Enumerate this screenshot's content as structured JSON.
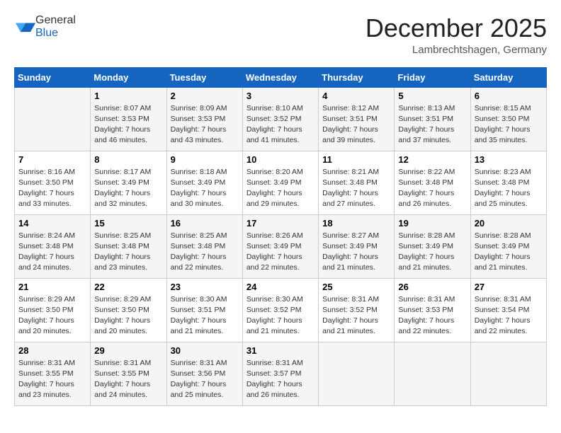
{
  "header": {
    "logo_general": "General",
    "logo_blue": "Blue",
    "month_title": "December 2025",
    "location": "Lambrechtshagen, Germany"
  },
  "days_of_week": [
    "Sunday",
    "Monday",
    "Tuesday",
    "Wednesday",
    "Thursday",
    "Friday",
    "Saturday"
  ],
  "weeks": [
    [
      {
        "num": "",
        "info": ""
      },
      {
        "num": "1",
        "info": "Sunrise: 8:07 AM\nSunset: 3:53 PM\nDaylight: 7 hours\nand 46 minutes."
      },
      {
        "num": "2",
        "info": "Sunrise: 8:09 AM\nSunset: 3:53 PM\nDaylight: 7 hours\nand 43 minutes."
      },
      {
        "num": "3",
        "info": "Sunrise: 8:10 AM\nSunset: 3:52 PM\nDaylight: 7 hours\nand 41 minutes."
      },
      {
        "num": "4",
        "info": "Sunrise: 8:12 AM\nSunset: 3:51 PM\nDaylight: 7 hours\nand 39 minutes."
      },
      {
        "num": "5",
        "info": "Sunrise: 8:13 AM\nSunset: 3:51 PM\nDaylight: 7 hours\nand 37 minutes."
      },
      {
        "num": "6",
        "info": "Sunrise: 8:15 AM\nSunset: 3:50 PM\nDaylight: 7 hours\nand 35 minutes."
      }
    ],
    [
      {
        "num": "7",
        "info": "Sunrise: 8:16 AM\nSunset: 3:50 PM\nDaylight: 7 hours\nand 33 minutes."
      },
      {
        "num": "8",
        "info": "Sunrise: 8:17 AM\nSunset: 3:49 PM\nDaylight: 7 hours\nand 32 minutes."
      },
      {
        "num": "9",
        "info": "Sunrise: 8:18 AM\nSunset: 3:49 PM\nDaylight: 7 hours\nand 30 minutes."
      },
      {
        "num": "10",
        "info": "Sunrise: 8:20 AM\nSunset: 3:49 PM\nDaylight: 7 hours\nand 29 minutes."
      },
      {
        "num": "11",
        "info": "Sunrise: 8:21 AM\nSunset: 3:48 PM\nDaylight: 7 hours\nand 27 minutes."
      },
      {
        "num": "12",
        "info": "Sunrise: 8:22 AM\nSunset: 3:48 PM\nDaylight: 7 hours\nand 26 minutes."
      },
      {
        "num": "13",
        "info": "Sunrise: 8:23 AM\nSunset: 3:48 PM\nDaylight: 7 hours\nand 25 minutes."
      }
    ],
    [
      {
        "num": "14",
        "info": "Sunrise: 8:24 AM\nSunset: 3:48 PM\nDaylight: 7 hours\nand 24 minutes."
      },
      {
        "num": "15",
        "info": "Sunrise: 8:25 AM\nSunset: 3:48 PM\nDaylight: 7 hours\nand 23 minutes."
      },
      {
        "num": "16",
        "info": "Sunrise: 8:25 AM\nSunset: 3:48 PM\nDaylight: 7 hours\nand 22 minutes."
      },
      {
        "num": "17",
        "info": "Sunrise: 8:26 AM\nSunset: 3:49 PM\nDaylight: 7 hours\nand 22 minutes."
      },
      {
        "num": "18",
        "info": "Sunrise: 8:27 AM\nSunset: 3:49 PM\nDaylight: 7 hours\nand 21 minutes."
      },
      {
        "num": "19",
        "info": "Sunrise: 8:28 AM\nSunset: 3:49 PM\nDaylight: 7 hours\nand 21 minutes."
      },
      {
        "num": "20",
        "info": "Sunrise: 8:28 AM\nSunset: 3:49 PM\nDaylight: 7 hours\nand 21 minutes."
      }
    ],
    [
      {
        "num": "21",
        "info": "Sunrise: 8:29 AM\nSunset: 3:50 PM\nDaylight: 7 hours\nand 20 minutes."
      },
      {
        "num": "22",
        "info": "Sunrise: 8:29 AM\nSunset: 3:50 PM\nDaylight: 7 hours\nand 20 minutes."
      },
      {
        "num": "23",
        "info": "Sunrise: 8:30 AM\nSunset: 3:51 PM\nDaylight: 7 hours\nand 21 minutes."
      },
      {
        "num": "24",
        "info": "Sunrise: 8:30 AM\nSunset: 3:52 PM\nDaylight: 7 hours\nand 21 minutes."
      },
      {
        "num": "25",
        "info": "Sunrise: 8:31 AM\nSunset: 3:52 PM\nDaylight: 7 hours\nand 21 minutes."
      },
      {
        "num": "26",
        "info": "Sunrise: 8:31 AM\nSunset: 3:53 PM\nDaylight: 7 hours\nand 22 minutes."
      },
      {
        "num": "27",
        "info": "Sunrise: 8:31 AM\nSunset: 3:54 PM\nDaylight: 7 hours\nand 22 minutes."
      }
    ],
    [
      {
        "num": "28",
        "info": "Sunrise: 8:31 AM\nSunset: 3:55 PM\nDaylight: 7 hours\nand 23 minutes."
      },
      {
        "num": "29",
        "info": "Sunrise: 8:31 AM\nSunset: 3:55 PM\nDaylight: 7 hours\nand 24 minutes."
      },
      {
        "num": "30",
        "info": "Sunrise: 8:31 AM\nSunset: 3:56 PM\nDaylight: 7 hours\nand 25 minutes."
      },
      {
        "num": "31",
        "info": "Sunrise: 8:31 AM\nSunset: 3:57 PM\nDaylight: 7 hours\nand 26 minutes."
      },
      {
        "num": "",
        "info": ""
      },
      {
        "num": "",
        "info": ""
      },
      {
        "num": "",
        "info": ""
      }
    ]
  ]
}
